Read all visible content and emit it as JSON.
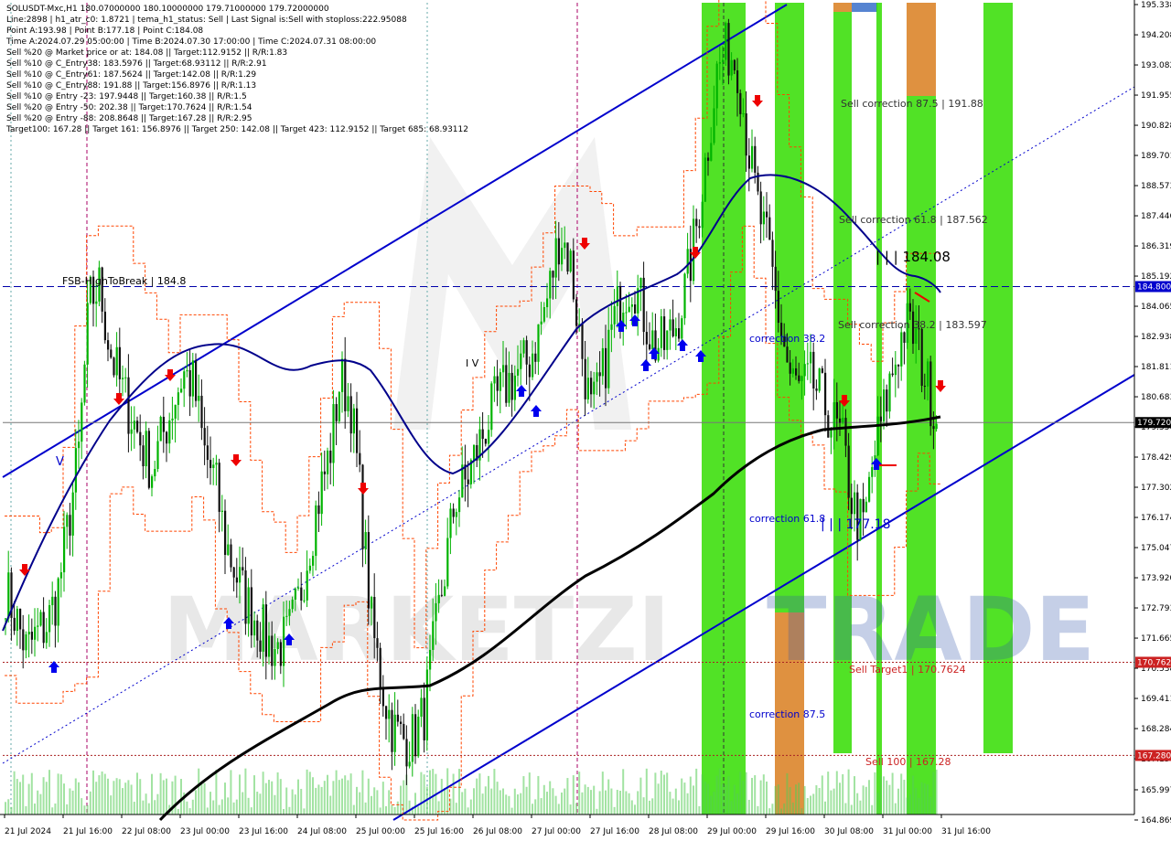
{
  "header": {
    "lines": [
      "SOLUSDT-Mxc,H1  180.07000000 180.10000000 179.71000000 179.72000000",
      "Line:2898 | h1_atr_c0: 1.8721 | tema_h1_status: Sell | Last Signal is:Sell with stoploss:222.95088",
      "Point A:193.98 | Point B:177.18 | Point C:184.08",
      "Time A:2024.07.29 05:00:00 | Time B:2024.07.30 17:00:00 | Time C:2024.07.31 08:00:00",
      "Sell %20 @ Market price or at: 184.08 || Target:112.9152 || R/R:1.83",
      "Sell %10 @ C_Entry38: 183.5976 || Target:68.93112 || R/R:2.91",
      "Sell %10 @ C_Entry61: 187.5624 || Target:142.08 || R/R:1.29",
      "Sell %10 @ C_Entry88: 191.88 || Target:156.8976 || R/R:1.13",
      "Sell %10 @ Entry -23: 197.9448 || Target:160.38 || R/R:1.5",
      "Sell %20 @ Entry -50: 202.38 || Target:170.7624 || R/R:1.54",
      "Sell %20 @ Entry -88: 208.8648 || Target:167.28 || R/R:2.95",
      "Target100: 167.28 || Target 161: 156.8976 || Target 250: 142.08 || Target 423: 112.9152 || Target 685: 68.93112"
    ]
  },
  "annotations": {
    "fsb": "FSB-HighToBreak | 184.8",
    "sell_corr_875": "Sell correction 87.5 | 191.88",
    "sell_corr_618": "Sell correction 61.8 | 187.562",
    "sell_corr_382": "Sell correction 38.2 | 183.597",
    "level_c": "| | | 184.08",
    "corr_382": "correction 38.2",
    "corr_618": "correction 61.8",
    "level_b": "| | | 177.18",
    "corr_875": "correction 87.5",
    "sell_target1": "Sell Target1 | 170.7624",
    "sell_100": "Sell 100 | 167.28",
    "iv": "I V",
    "v_mark": "V"
  },
  "watermark": {
    "main": "MARKETZI",
    "accent": "TRADE"
  },
  "colors": {
    "background": "#ffffff",
    "bull": "#00b300",
    "bear": "#111111",
    "channel": "#0000cc",
    "ma_dark": "#000000",
    "ma_blue": "#00008b",
    "orange_band": "#ff4500",
    "green_zone": "#33dd00",
    "orange_zone": "#ee8844",
    "price_tag": "#0000cd",
    "red_tag": "#cc2222",
    "dark_tag": "#000000"
  },
  "chart_data": {
    "type": "candlestick",
    "symbol": "SOLUSDT-Mxc",
    "timeframe": "H1",
    "ohlc_last": {
      "open": 180.07,
      "high": 180.1,
      "low": 179.71,
      "close": 179.72
    },
    "ylim": [
      164.869,
      195.338
    ],
    "y_ticks": [
      "195.338",
      "194.208",
      "193.082",
      "191.955",
      "190.828",
      "189.701",
      "188.573",
      "187.446",
      "186.319",
      "185.192",
      "184.065",
      "182.938",
      "181.811",
      "180.683",
      "179.556",
      "178.429",
      "177.302",
      "176.174",
      "175.047",
      "173.920",
      "172.793",
      "171.665",
      "170.538",
      "169.411",
      "168.284",
      "167.156",
      "165.997",
      "164.869"
    ],
    "x_ticks": [
      "21 Jul 2024",
      "21 Jul 16:00",
      "22 Jul 08:00",
      "23 Jul 00:00",
      "23 Jul 16:00",
      "24 Jul 08:00",
      "25 Jul 00:00",
      "25 Jul 16:00",
      "26 Jul 08:00",
      "27 Jul 00:00",
      "27 Jul 16:00",
      "28 Jul 08:00",
      "29 Jul 00:00",
      "29 Jul 16:00",
      "30 Jul 08:00",
      "31 Jul 00:00",
      "31 Jul 16:00"
    ],
    "price_tags": {
      "fsb": {
        "label": "184.800",
        "value": 184.8
      },
      "current": {
        "label": "179.720",
        "value": 179.72
      },
      "target1": {
        "label": "170.7624",
        "value": 170.7624
      },
      "target100": {
        "label": "167.280",
        "value": 167.28
      }
    },
    "levels": {
      "fsb_high_to_break": 184.8,
      "current_price": 179.72,
      "sell_target1": 170.7624,
      "sell_100": 167.28
    },
    "close_path": [
      173.5,
      172.4,
      171.2,
      171.8,
      172.2,
      173.4,
      175.9,
      178.6,
      184.2,
      184.8,
      182.4,
      181.1,
      180.0,
      178.9,
      178.0,
      179.2,
      180.4,
      181.6,
      181.1,
      178.6,
      177.6,
      175.3,
      174.1,
      173.0,
      172.4,
      171.5,
      171.3,
      171.7,
      173.0,
      175.1,
      177.0,
      178.6,
      181.4,
      180.5,
      176.7,
      172.1,
      169.9,
      168.3,
      167.9,
      167.9,
      168.8,
      171.6,
      174.2,
      176.9,
      177.5,
      178.6,
      179.7,
      180.6,
      181.2,
      181.6,
      182.0,
      183.1,
      184.7,
      186.9,
      185.7,
      182.6,
      180.0,
      181.3,
      183.3,
      184.6,
      185.1,
      183.8,
      182.6,
      182.6,
      183.3,
      184.7,
      186.9,
      189.7,
      192.8,
      193.7,
      193.1,
      190.0,
      187.6,
      186.0,
      183.5,
      181.4,
      180.9,
      181.3,
      180.6,
      179.8,
      179.0,
      176.6,
      175.7,
      178.4,
      180.2,
      182.0,
      183.4,
      182.9,
      181.3,
      179.9
    ]
  }
}
